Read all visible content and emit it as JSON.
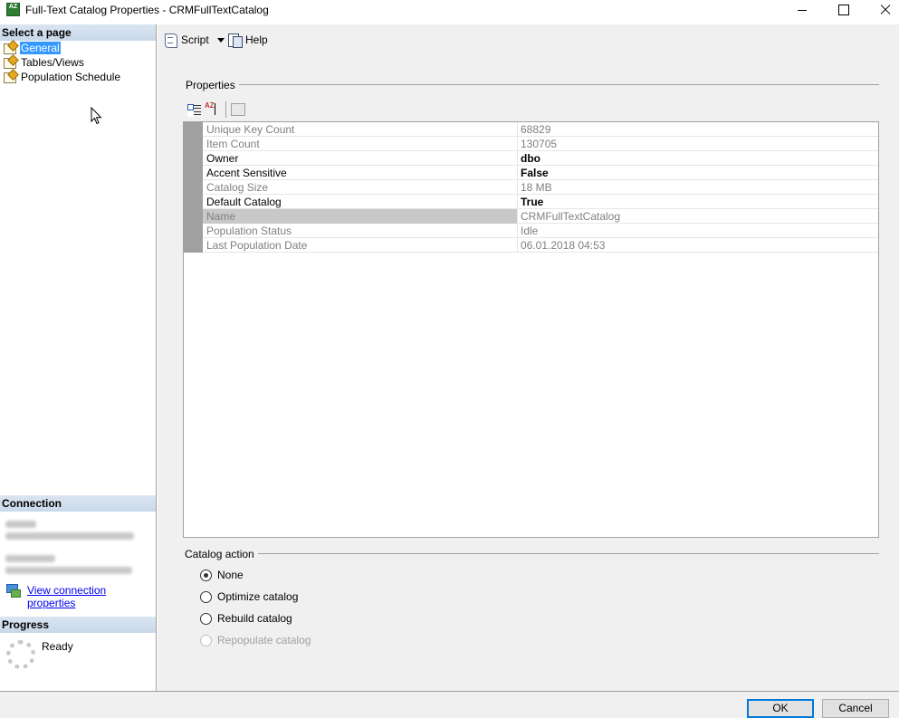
{
  "window": {
    "title": "Full-Text Catalog Properties - CRMFullTextCatalog",
    "icon_text": "AZ"
  },
  "left": {
    "select_page_header": "Select a page",
    "pages": [
      {
        "label": "General",
        "selected": true
      },
      {
        "label": "Tables/Views",
        "selected": false
      },
      {
        "label": "Population Schedule",
        "selected": false
      }
    ],
    "connection_header": "Connection",
    "view_connection_link": "View connection properties",
    "progress_header": "Progress",
    "progress_status": "Ready"
  },
  "toolbar": {
    "script_label": "Script",
    "help_label": "Help"
  },
  "properties": {
    "group_label": "Properties",
    "sort_az_label": "AZ",
    "rows": [
      {
        "name": "Unique Key Count",
        "value": "68829",
        "editable": false
      },
      {
        "name": "Item Count",
        "value": "130705",
        "editable": false
      },
      {
        "name": "Owner",
        "value": "dbo",
        "editable": true
      },
      {
        "name": "Accent Sensitive",
        "value": "False",
        "editable": true
      },
      {
        "name": "Catalog Size",
        "value": "18 MB",
        "editable": false
      },
      {
        "name": "Default Catalog",
        "value": "True",
        "editable": true
      },
      {
        "name": "Name",
        "value": "CRMFullTextCatalog",
        "editable": false,
        "selected": true
      },
      {
        "name": "Population Status",
        "value": "Idle",
        "editable": false
      },
      {
        "name": "Last Population Date",
        "value": "06.01.2018 04:53",
        "editable": false
      }
    ]
  },
  "catalog_action": {
    "group_label": "Catalog action",
    "options": [
      {
        "label": "None",
        "checked": true,
        "enabled": true
      },
      {
        "label": "Optimize catalog",
        "checked": false,
        "enabled": true
      },
      {
        "label": "Rebuild catalog",
        "checked": false,
        "enabled": true
      },
      {
        "label": "Repopulate catalog",
        "checked": false,
        "enabled": false
      }
    ]
  },
  "buttons": {
    "ok": "OK",
    "cancel": "Cancel"
  },
  "colors": {
    "selection": "#3399ff",
    "header_band": "#c9d8ea",
    "dialog_bg": "#f0f0f0",
    "default_button_border": "#0078d7"
  }
}
